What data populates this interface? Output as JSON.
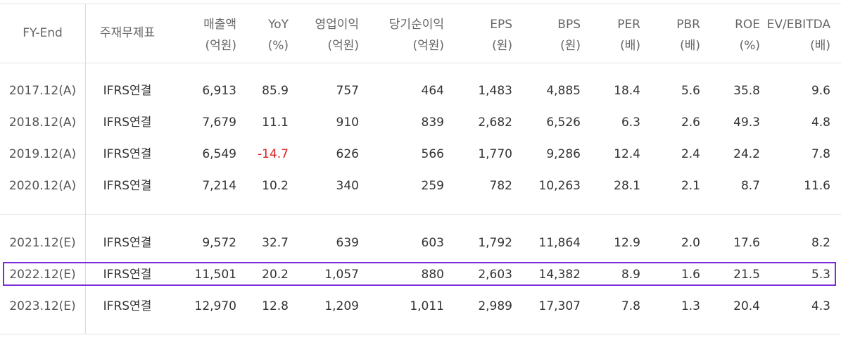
{
  "table": {
    "headers": [
      {
        "l1": "FY-End",
        "l2": ""
      },
      {
        "l1": "주재무제표",
        "l2": ""
      },
      {
        "l1": "매출액",
        "l2": "(억원)"
      },
      {
        "l1": "YoY",
        "l2": "(%)"
      },
      {
        "l1": "영업이익",
        "l2": "(억원)"
      },
      {
        "l1": "당기순이익",
        "l2": "(억원)"
      },
      {
        "l1": "EPS",
        "l2": "(원)"
      },
      {
        "l1": "BPS",
        "l2": "(원)"
      },
      {
        "l1": "PER",
        "l2": "(배)"
      },
      {
        "l1": "PBR",
        "l2": "(배)"
      },
      {
        "l1": "ROE",
        "l2": "(%)"
      },
      {
        "l1": "EV/EBITDA",
        "l2": "(배)"
      }
    ],
    "rows": [
      [
        "2017.12(A)",
        "IFRS연결",
        "6,913",
        "85.9",
        "757",
        "464",
        "1,483",
        "4,885",
        "18.4",
        "5.6",
        "35.8",
        "9.6"
      ],
      [
        "2018.12(A)",
        "IFRS연결",
        "7,679",
        "11.1",
        "910",
        "839",
        "2,682",
        "6,526",
        "6.3",
        "2.6",
        "49.3",
        "4.8"
      ],
      [
        "2019.12(A)",
        "IFRS연결",
        "6,549",
        "-14.7",
        "626",
        "566",
        "1,770",
        "9,286",
        "12.4",
        "2.4",
        "24.2",
        "7.8"
      ],
      [
        "2020.12(A)",
        "IFRS연결",
        "7,214",
        "10.2",
        "340",
        "259",
        "782",
        "10,263",
        "28.1",
        "2.1",
        "8.7",
        "11.6"
      ],
      [
        "2021.12(E)",
        "IFRS연결",
        "9,572",
        "32.7",
        "639",
        "603",
        "1,792",
        "11,864",
        "12.9",
        "2.0",
        "17.6",
        "8.2"
      ],
      [
        "2022.12(E)",
        "IFRS연결",
        "11,501",
        "20.2",
        "1,057",
        "880",
        "2,603",
        "14,382",
        "8.9",
        "1.6",
        "21.5",
        "5.3"
      ],
      [
        "2023.12(E)",
        "IFRS연결",
        "12,970",
        "12.8",
        "1,209",
        "1,011",
        "2,989",
        "17,307",
        "7.8",
        "1.3",
        "20.4",
        "4.3"
      ]
    ],
    "negative_color": "#e02020",
    "highlight_color": "#7b2bd9",
    "highlighted_row": "2022.12(E)"
  }
}
